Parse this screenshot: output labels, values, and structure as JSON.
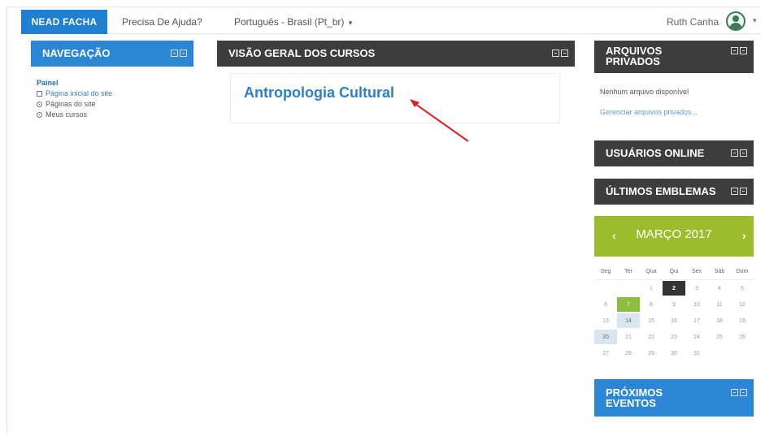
{
  "navbar": {
    "brand": "NEAD FACHA",
    "help": "Precisa De Ajuda?",
    "language": "Português - Brasil (Pt_br)",
    "language_caret": "▾",
    "user_name": "Ruth Canha",
    "user_caret": "▾"
  },
  "navigation": {
    "title": "NAVEGAÇÃO",
    "root": "Painel",
    "items": [
      {
        "label": "Página inicial do site",
        "icon": "page-icon"
      },
      {
        "label": "Páginas do site",
        "icon": "expand-icon"
      },
      {
        "label": "Meus cursos",
        "icon": "expand-icon"
      }
    ]
  },
  "course_overview": {
    "title": "VISÃO GERAL DOS CURSOS",
    "course_name": "Antropologia Cultural"
  },
  "private_files": {
    "title_line1": "ARQUIVOS",
    "title_line2": "PRIVADOS",
    "empty": "Nenhum arquivo disponível",
    "manage": "Gerenciar arquivos privados..."
  },
  "online_users": {
    "title": "USUÁRIOS ONLINE"
  },
  "latest_badges": {
    "title": "ÚLTIMOS EMBLEMAS"
  },
  "calendar": {
    "title": "MARÇO 2017",
    "prev": "‹",
    "next": "›",
    "weekdays": [
      "Seg",
      "Ter",
      "Qua",
      "Qui",
      "Sex",
      "Sáb",
      "Dom"
    ],
    "weeks": [
      [
        "",
        "",
        "1",
        "2",
        "3",
        "4",
        "5"
      ],
      [
        "6",
        "7",
        "8",
        "9",
        "10",
        "11",
        "12"
      ],
      [
        "13",
        "14",
        "15",
        "16",
        "17",
        "18",
        "19"
      ],
      [
        "20",
        "21",
        "22",
        "23",
        "24",
        "25",
        "26"
      ],
      [
        "27",
        "28",
        "29",
        "30",
        "31",
        "",
        ""
      ]
    ]
  },
  "upcoming_events": {
    "title_line1": "PRÓXIMOS",
    "title_line2": "EVENTOS"
  },
  "colors": {
    "brand_blue": "#1f7fd1",
    "block_blue": "#2b86d6",
    "block_dark": "#3d3d3d",
    "calendar_green": "#9bbd2b",
    "annotation_red": "#e02020"
  }
}
